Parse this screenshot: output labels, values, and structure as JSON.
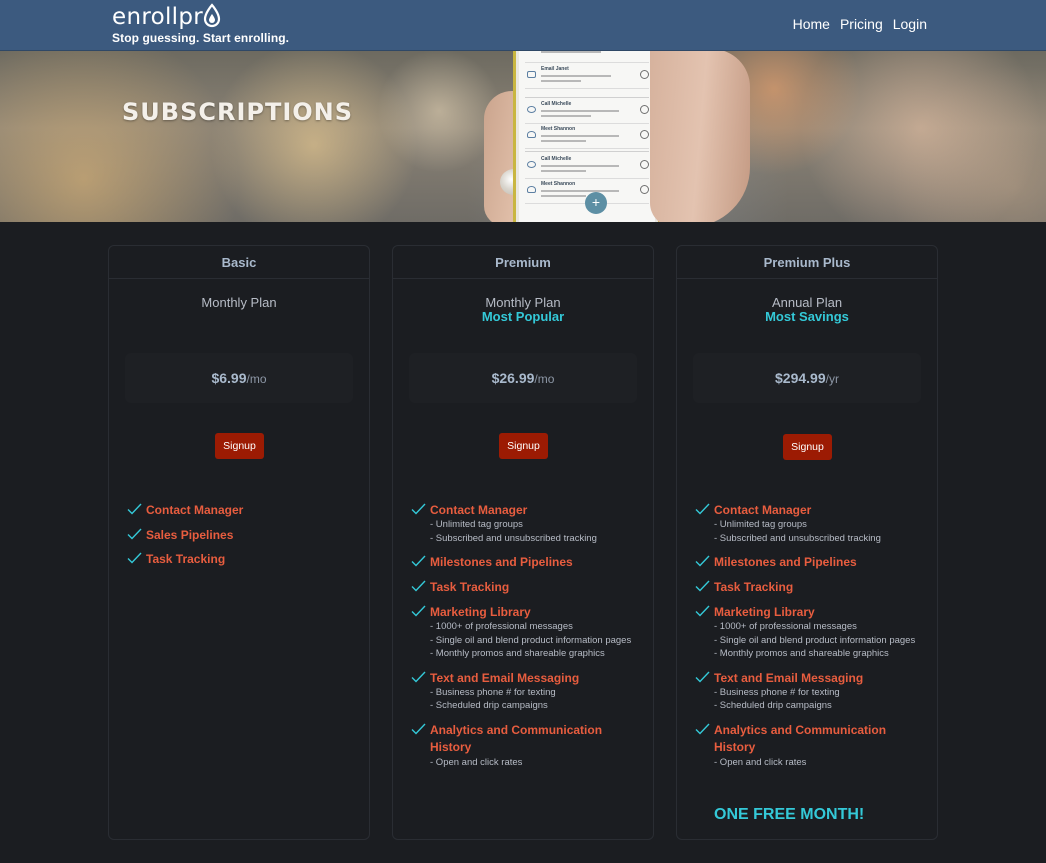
{
  "brand": {
    "name": "enrollpr",
    "tagline": "Stop guessing. Start enrolling."
  },
  "nav": {
    "items": [
      "Home",
      "Pricing",
      "Login"
    ]
  },
  "hero": {
    "title": "SUBSCRIPTIONS",
    "phone": {
      "rows": [
        {
          "name": "Email Janet"
        },
        {
          "name": "Call Michelle"
        },
        {
          "name": "Meet Shannon"
        },
        {
          "name": "Call Michelle"
        },
        {
          "name": "Meet Shannon"
        }
      ],
      "fab": "+"
    }
  },
  "colors": {
    "accent": "#e85d3f",
    "highlight": "#34c9d8",
    "button": "#9c1b03",
    "header": "#3c5a7f"
  },
  "plans": [
    {
      "name": "Basic",
      "type": "Monthly Plan",
      "tag": "",
      "price": "$6.99",
      "period": "/mo",
      "button": "Signup",
      "features": [
        {
          "title": "Contact Manager",
          "items": []
        },
        {
          "title": "Sales Pipelines",
          "items": []
        },
        {
          "title": "Task Tracking",
          "items": []
        }
      ],
      "bonus": ""
    },
    {
      "name": "Premium",
      "type": "Monthly Plan",
      "tag": "Most Popular",
      "price": "$26.99",
      "period": "/mo",
      "button": "Signup",
      "features": [
        {
          "title": "Contact Manager",
          "items": [
            "- Unlimited tag groups",
            "- Subscribed and unsubscribed tracking"
          ]
        },
        {
          "title": "Milestones and Pipelines",
          "items": []
        },
        {
          "title": "Task Tracking",
          "items": []
        },
        {
          "title": "Marketing Library",
          "items": [
            "- 1000+ of professional messages",
            "- Single oil and blend product information pages",
            "- Monthly promos and shareable graphics"
          ]
        },
        {
          "title": "Text and Email Messaging",
          "items": [
            "- Business phone # for texting",
            "- Scheduled drip campaigns"
          ]
        },
        {
          "title": "Analytics and Communication History",
          "items": [
            "- Open and click rates"
          ]
        }
      ],
      "bonus": ""
    },
    {
      "name": "Premium Plus",
      "type": "Annual Plan",
      "tag": "Most Savings",
      "price": "$294.99",
      "period": "/yr",
      "button": "Signup",
      "features": [
        {
          "title": "Contact Manager",
          "items": [
            "- Unlimited tag groups",
            "- Subscribed and unsubscribed tracking"
          ]
        },
        {
          "title": "Milestones and Pipelines",
          "items": []
        },
        {
          "title": "Task Tracking",
          "items": []
        },
        {
          "title": "Marketing Library",
          "items": [
            "- 1000+ of professional messages",
            "- Single oil and blend product information pages",
            "- Monthly promos and shareable graphics"
          ]
        },
        {
          "title": "Text and Email Messaging",
          "items": [
            "- Business phone # for texting",
            "- Scheduled drip campaigns"
          ]
        },
        {
          "title": "Analytics and Communication History",
          "items": [
            "- Open and click rates"
          ]
        }
      ],
      "bonus": "ONE FREE MONTH!"
    }
  ]
}
